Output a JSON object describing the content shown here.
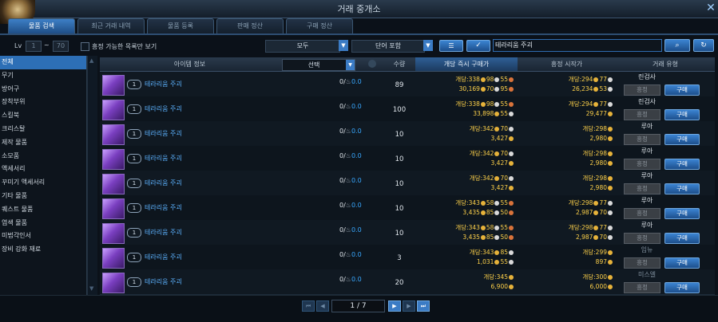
{
  "window": {
    "title": "거래 중개소"
  },
  "tabs": [
    {
      "label": "물품 검색"
    },
    {
      "label": "최근 거래 내역"
    },
    {
      "label": "물품 등록"
    },
    {
      "label": "판매 정산"
    },
    {
      "label": "구매 정산"
    }
  ],
  "filters": {
    "lv_label": "Lv",
    "lv_min": "1",
    "lv_sep": "~",
    "lv_max": "70",
    "only_bid_label": "흥정 가능한 목록만 보기",
    "grade_select": "모두",
    "match_select": "단어 포함",
    "search_value": "테라리움 주괴"
  },
  "categories": [
    "전체",
    "무기",
    "방어구",
    "장착부위",
    "스킬북",
    "크리스탈",
    "제작 물품",
    "소모품",
    "액세서리",
    "꾸미기 액세서리",
    "기타 물품",
    "퀘스트 물품",
    "염색 물품",
    "미법각인서",
    "장비 강화 재료"
  ],
  "table_headers": {
    "item_info": "아이템 정보",
    "select": "선택",
    "qty": "수량",
    "instant_price": "개당 즉시 구매가",
    "bid_start": "흥정 시작가",
    "trade_type": "거래 유형"
  },
  "rows": [
    {
      "name": "테라리움 주괴",
      "lv": "1",
      "stock_left": "0/",
      "stock_val": "0.0",
      "qty": "89",
      "inst_unit": [
        "개당:",
        "338",
        "98",
        "55"
      ],
      "inst_total": [
        "30,169",
        "70",
        "95"
      ],
      "bid_unit": [
        "개당:",
        "294",
        "77"
      ],
      "bid_total": [
        "26,234",
        "53"
      ],
      "seller": "린검사",
      "seller_dim": false,
      "bid_label": "흥정",
      "buy_label": "구매"
    },
    {
      "name": "테라리움 주괴",
      "lv": "1",
      "stock_left": "0/",
      "stock_val": "0.0",
      "qty": "100",
      "inst_unit": [
        "개당:",
        "338",
        "98",
        "55"
      ],
      "inst_total": [
        "33,898",
        "55"
      ],
      "bid_unit": [
        "개당:",
        "294",
        "77"
      ],
      "bid_total": [
        "29,477"
      ],
      "seller": "린검사",
      "seller_dim": false,
      "bid_label": "흥정",
      "buy_label": "구매"
    },
    {
      "name": "테라리움 주괴",
      "lv": "1",
      "stock_left": "0/",
      "stock_val": "0.0",
      "qty": "10",
      "inst_unit": [
        "개당:",
        "342",
        "70"
      ],
      "inst_total": [
        "3,427"
      ],
      "bid_unit": [
        "개당:",
        "298"
      ],
      "bid_total": [
        "2,980"
      ],
      "seller": "루아",
      "seller_dim": false,
      "bid_label": "흥정",
      "buy_label": "구매"
    },
    {
      "name": "테라리움 주괴",
      "lv": "1",
      "stock_left": "0/",
      "stock_val": "0.0",
      "qty": "10",
      "inst_unit": [
        "개당:",
        "342",
        "70"
      ],
      "inst_total": [
        "3,427"
      ],
      "bid_unit": [
        "개당:",
        "298"
      ],
      "bid_total": [
        "2,980"
      ],
      "seller": "루아",
      "seller_dim": false,
      "bid_label": "흥정",
      "buy_label": "구매"
    },
    {
      "name": "테라리움 주괴",
      "lv": "1",
      "stock_left": "0/",
      "stock_val": "0.0",
      "qty": "10",
      "inst_unit": [
        "개당:",
        "342",
        "70"
      ],
      "inst_total": [
        "3,427"
      ],
      "bid_unit": [
        "개당:",
        "298"
      ],
      "bid_total": [
        "2,980"
      ],
      "seller": "루아",
      "seller_dim": false,
      "bid_label": "흥정",
      "buy_label": "구매"
    },
    {
      "name": "테라리움 주괴",
      "lv": "1",
      "stock_left": "0/",
      "stock_val": "0.0",
      "qty": "10",
      "inst_unit": [
        "개당:",
        "343",
        "58",
        "55"
      ],
      "inst_total": [
        "3,435",
        "85",
        "50"
      ],
      "bid_unit": [
        "개당:",
        "298",
        "77"
      ],
      "bid_total": [
        "2,987",
        "70"
      ],
      "seller": "루아",
      "seller_dim": false,
      "bid_label": "흥정",
      "buy_label": "구매"
    },
    {
      "name": "테라리움 주괴",
      "lv": "1",
      "stock_left": "0/",
      "stock_val": "0.0",
      "qty": "10",
      "inst_unit": [
        "개당:",
        "343",
        "58",
        "55"
      ],
      "inst_total": [
        "3,435",
        "85",
        "50"
      ],
      "bid_unit": [
        "개당:",
        "298",
        "77"
      ],
      "bid_total": [
        "2,987",
        "70"
      ],
      "seller": "루아",
      "seller_dim": false,
      "bid_label": "흥정",
      "buy_label": "구매"
    },
    {
      "name": "테라리움 주괴",
      "lv": "1",
      "stock_left": "0/",
      "stock_val": "0.0",
      "qty": "3",
      "inst_unit": [
        "개당:",
        "343",
        "85"
      ],
      "inst_total": [
        "1,031",
        "55"
      ],
      "bid_unit": [
        "개당:",
        "299"
      ],
      "bid_total": [
        "897"
      ],
      "seller": "임뉴",
      "seller_dim": true,
      "bid_label": "흥정",
      "buy_label": "구매"
    },
    {
      "name": "테라리움 주괴",
      "lv": "1",
      "stock_left": "0/",
      "stock_val": "0.0",
      "qty": "20",
      "inst_unit": [
        "개당:",
        "345"
      ],
      "inst_total": [
        "6,900"
      ],
      "bid_unit": [
        "개당:",
        "300"
      ],
      "bid_total": [
        "6,000"
      ],
      "seller": "미스엘",
      "seller_dim": true,
      "bid_label": "흥정",
      "buy_label": "구매"
    }
  ],
  "pagination": {
    "page": "1 / 7"
  }
}
